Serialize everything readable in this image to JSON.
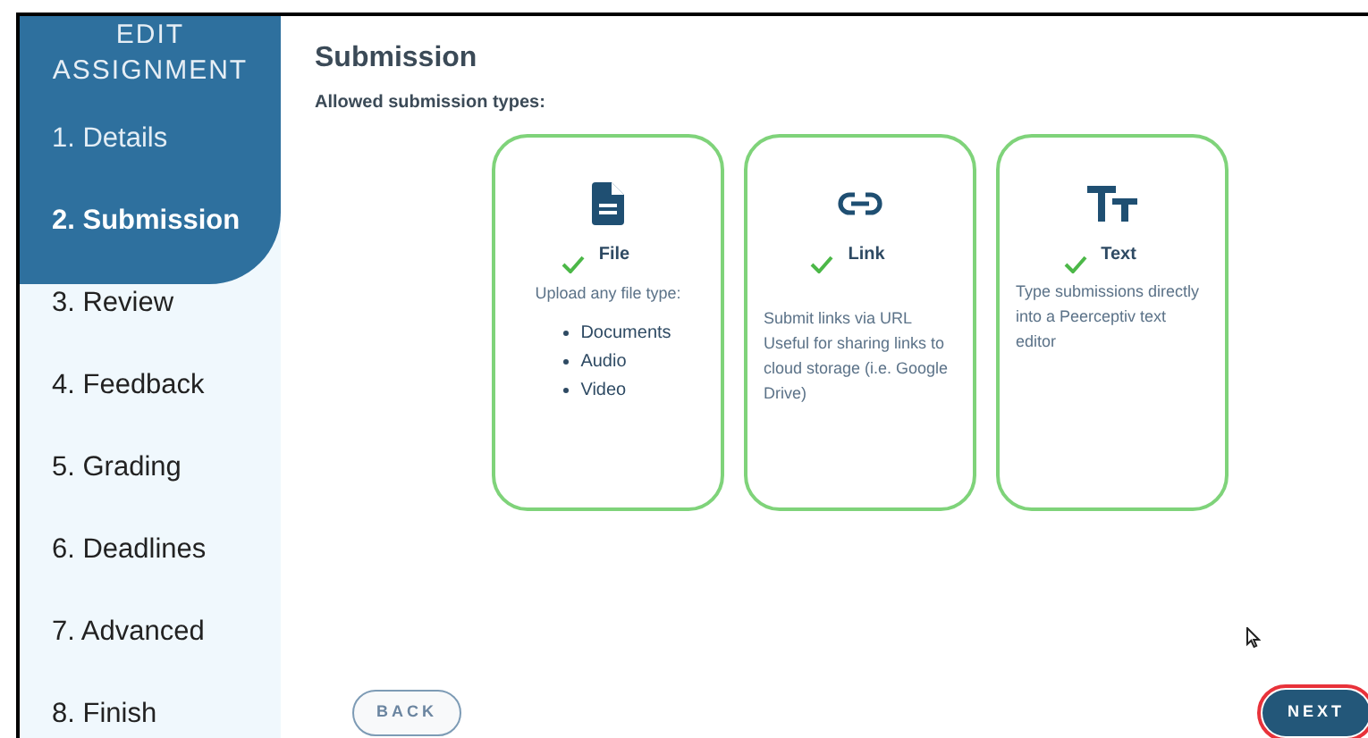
{
  "sidebar": {
    "title": "EDIT ASSIGNMENT",
    "items": [
      {
        "label": "1. Details",
        "selected": false
      },
      {
        "label": "2. Submission",
        "selected": true
      },
      {
        "label": "3. Review",
        "selected": false
      },
      {
        "label": "4. Feedback",
        "selected": false
      },
      {
        "label": "5. Grading",
        "selected": false
      },
      {
        "label": "6. Deadlines",
        "selected": false
      },
      {
        "label": "7. Advanced",
        "selected": false
      },
      {
        "label": "8. Finish",
        "selected": false
      }
    ]
  },
  "main": {
    "title": "Submission",
    "subtitle": "Allowed submission types:",
    "types": [
      {
        "kind": "file",
        "name": "File",
        "checked": true,
        "description": "Upload any file type:",
        "bullets": [
          "Documents",
          "Audio",
          "Video"
        ]
      },
      {
        "kind": "link",
        "name": "Link",
        "checked": true,
        "description": "Submit links via URL Useful for sharing links to cloud storage (i.e. Google Drive)"
      },
      {
        "kind": "text",
        "name": "Text",
        "checked": true,
        "description": "Type submissions directly into a Peerceptiv text editor"
      }
    ]
  },
  "buttons": {
    "back": "BACK",
    "next": {
      "label": "NEXT",
      "highlighted": true
    }
  }
}
